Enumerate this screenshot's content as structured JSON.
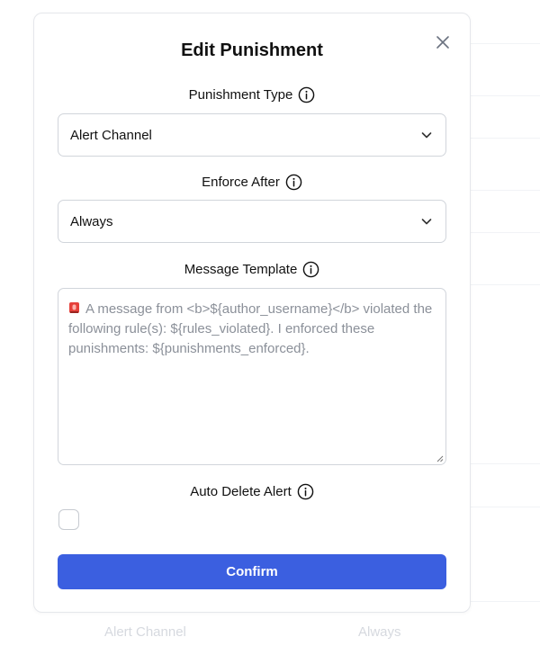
{
  "modal": {
    "title": "Edit Punishment",
    "punishment_type": {
      "label": "Punishment Type",
      "value": "Alert Channel"
    },
    "enforce_after": {
      "label": "Enforce After",
      "value": "Always"
    },
    "message_template": {
      "label": "Message Template",
      "placeholder": "A message from <b>${author_username}</b> violated the following rule(s): ${rules_violated}. I enforced these punishments: ${punishments_enforced}."
    },
    "auto_delete": {
      "label": "Auto Delete Alert",
      "checked": false
    },
    "confirm_label": "Confirm"
  },
  "background_row": {
    "col1": "Alert Channel",
    "col2": "Always"
  },
  "colors": {
    "accent": "#3b5fe0",
    "alarm": "#e5403a"
  }
}
